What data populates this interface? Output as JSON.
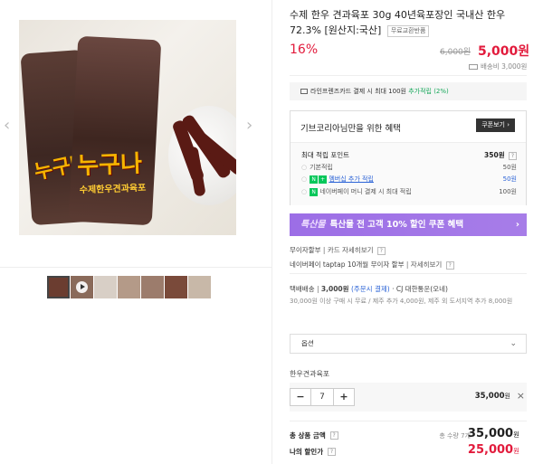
{
  "product": {
    "title": "수제 한우 견과육포 30g 40년육포장인 국내산 한우 72.3% [원산지:국산]",
    "exchange_badge": "무료교환반품",
    "discount_rate": "16%",
    "original_price": "6,000원",
    "sale_price": "5,000원",
    "shipping_fee": "배송비 3,000원",
    "package_label": "누구나",
    "package_sub": "수제한우견과육포"
  },
  "card_banner": {
    "text_prefix": "라인프렌즈카드 결제 시 최대 100원 ",
    "highlight": "추가적립 (2%)",
    "chevron": ">"
  },
  "benefit": {
    "title": "기브코리아님만을 위한 혜택",
    "coupon_button": "쿠폰보기",
    "max_points_label": "최대 적립 포인트",
    "max_points_value": "350원",
    "rows": [
      {
        "label": "기본적립",
        "value": "50원"
      },
      {
        "label": "멤버십 추가 적립",
        "value": "50원"
      },
      {
        "label": "네이버페이 머니 결제 시 최대 적립",
        "value": "100원"
      }
    ]
  },
  "promo": {
    "logo": "특산물",
    "text": "특산물 전 고객 10% 할인 쿠폰 혜택",
    "chevron": "›"
  },
  "payment": {
    "interest_free": "무이자할부",
    "card_details": "카드 자세히보기",
    "naverpay_tap": "네이버페이 taptap 10개월 무이자 할부",
    "details_link": "자세히보기"
  },
  "delivery": {
    "method": "택배배송",
    "fee": "3,000원",
    "fee_note": "(주문시 결제)",
    "carrier": "· CJ 대한통운(오네)",
    "note": "30,000원 이상 구매 시 무료 / 제주 추가 4,000원, 제주 외 도서지역 추가 8,000원"
  },
  "option_select": {
    "placeholder": "옵션",
    "chevron": "⌄"
  },
  "selected_option": {
    "name": "한우견과육포",
    "minus": "−",
    "quantity": "7",
    "plus": "+",
    "price": "35,000",
    "price_unit": "원",
    "remove": "×"
  },
  "totals": {
    "total_label": "총 상품 금액",
    "total_count": "총 수량 7개",
    "total_amount": "35,000",
    "amount_unit": "원",
    "discount_label": "나의 할인가",
    "discount_amount": "25,000"
  }
}
